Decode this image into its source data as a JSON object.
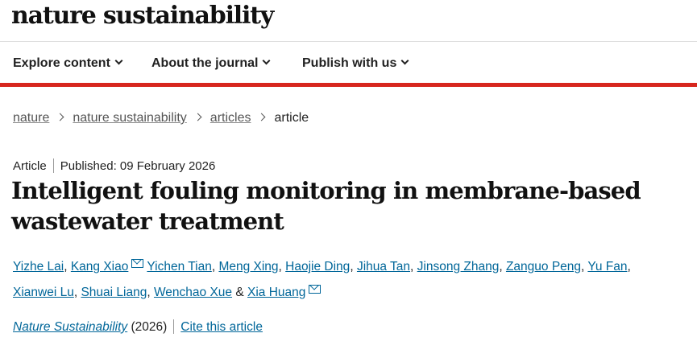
{
  "header": {
    "logo_text": "nature sustainability"
  },
  "nav": {
    "items": [
      {
        "label": "Explore content"
      },
      {
        "label": "About the journal"
      },
      {
        "label": "Publish with us"
      }
    ]
  },
  "breadcrumb": {
    "links": [
      "nature",
      "nature sustainability",
      "articles"
    ],
    "current": "article"
  },
  "article": {
    "type": "Article",
    "published": "Published: 09 February 2026",
    "title": "Intelligent fouling monitoring in membrane-based wastewater treatment",
    "authors": [
      {
        "name": "Yizhe Lai",
        "sep": ", "
      },
      {
        "name": "Kang Xiao",
        "sep": " "
      },
      {
        "name": "Yichen Tian",
        "sep": ", "
      },
      {
        "name": "Meng Xing",
        "sep": ", "
      },
      {
        "name": "Haojie Ding",
        "sep": ", "
      },
      {
        "name": "Jihua Tan",
        "sep": ", "
      },
      {
        "name": "Jinsong Zhang",
        "sep": ", "
      },
      {
        "name": "Zanguo Peng",
        "sep": ", "
      },
      {
        "name": "Yu Fan",
        "sep": ", "
      },
      {
        "name": "Xianwei Lu",
        "sep": ", "
      },
      {
        "name": "Shuai Liang",
        "sep": ", "
      },
      {
        "name": "Wenchao Xue",
        "sep": " & "
      },
      {
        "name": "Xia Huang",
        "sep": ""
      }
    ],
    "journal": "Nature Sustainability",
    "year": "(2026)",
    "cite_label": "Cite this article"
  },
  "colors": {
    "accent_bar": "#d7261e",
    "link": "#006699"
  }
}
